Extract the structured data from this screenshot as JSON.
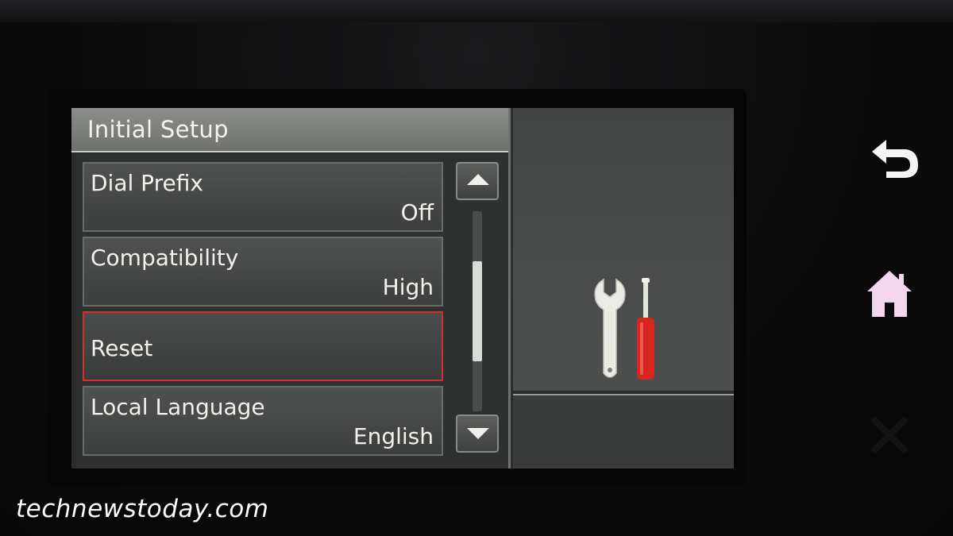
{
  "screen": {
    "title": "Initial Setup"
  },
  "menu": {
    "items": [
      {
        "label": "Dial Prefix",
        "value": "Off"
      },
      {
        "label": "Compatibility",
        "value": "High"
      },
      {
        "label": "Reset",
        "value": ""
      },
      {
        "label": "Local Language",
        "value": "English"
      }
    ],
    "selected_index": 2
  },
  "scrollbar": {
    "position_fraction": 0.5,
    "thumb_fraction": 0.5
  },
  "icons": {
    "up": "chevron-up-icon",
    "down": "chevron-down-icon",
    "tools": "wrench-screwdriver-icon",
    "back": "back-arrow-icon",
    "home": "home-icon",
    "cancel": "close-icon"
  },
  "colors": {
    "selection_border": "#d5302e",
    "screwdriver_red": "#d8261f",
    "home_glow": "#f3d7ee"
  },
  "watermark": "technewstoday.com"
}
